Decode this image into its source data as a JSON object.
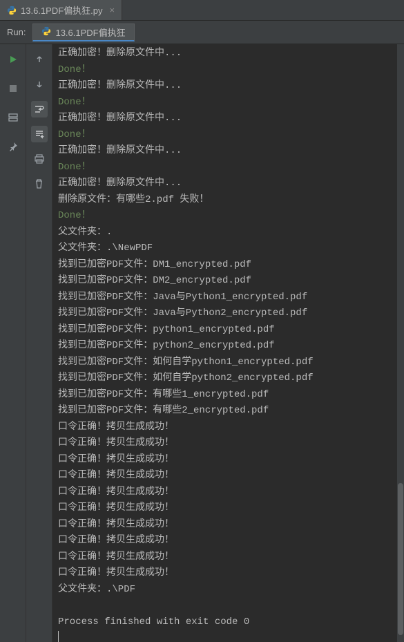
{
  "file_tab": {
    "label": "13.6.1PDF偏执狂.py"
  },
  "run": {
    "label": "Run:",
    "config": "13.6.1PDF偏执狂"
  },
  "console_lines": [
    {
      "cls": "",
      "text": "正确加密！删除原文件中..."
    },
    {
      "cls": "green",
      "text": "Done！"
    },
    {
      "cls": "",
      "text": "正确加密！删除原文件中..."
    },
    {
      "cls": "green",
      "text": "Done！"
    },
    {
      "cls": "",
      "text": "正确加密！删除原文件中..."
    },
    {
      "cls": "green",
      "text": "Done！"
    },
    {
      "cls": "",
      "text": "正确加密！删除原文件中..."
    },
    {
      "cls": "green",
      "text": "Done！"
    },
    {
      "cls": "",
      "text": "正确加密！删除原文件中..."
    },
    {
      "cls": "",
      "text": "删除原文件：有哪些2.pdf 失败！"
    },
    {
      "cls": "green",
      "text": "Done！"
    },
    {
      "cls": "",
      "text": "父文件夹：."
    },
    {
      "cls": "",
      "text": "父文件夹：.\\NewPDF"
    },
    {
      "cls": "",
      "text": "找到已加密PDF文件：DM1_encrypted.pdf"
    },
    {
      "cls": "",
      "text": "找到已加密PDF文件：DM2_encrypted.pdf"
    },
    {
      "cls": "",
      "text": "找到已加密PDF文件：Java与Python1_encrypted.pdf"
    },
    {
      "cls": "",
      "text": "找到已加密PDF文件：Java与Python2_encrypted.pdf"
    },
    {
      "cls": "",
      "text": "找到已加密PDF文件：python1_encrypted.pdf"
    },
    {
      "cls": "",
      "text": "找到已加密PDF文件：python2_encrypted.pdf"
    },
    {
      "cls": "",
      "text": "找到已加密PDF文件：如何自学python1_encrypted.pdf"
    },
    {
      "cls": "",
      "text": "找到已加密PDF文件：如何自学python2_encrypted.pdf"
    },
    {
      "cls": "",
      "text": "找到已加密PDF文件：有哪些1_encrypted.pdf"
    },
    {
      "cls": "",
      "text": "找到已加密PDF文件：有哪些2_encrypted.pdf"
    },
    {
      "cls": "",
      "text": "口令正确！拷贝生成成功！"
    },
    {
      "cls": "",
      "text": "口令正确！拷贝生成成功！"
    },
    {
      "cls": "",
      "text": "口令正确！拷贝生成成功！"
    },
    {
      "cls": "",
      "text": "口令正确！拷贝生成成功！"
    },
    {
      "cls": "",
      "text": "口令正确！拷贝生成成功！"
    },
    {
      "cls": "",
      "text": "口令正确！拷贝生成成功！"
    },
    {
      "cls": "",
      "text": "口令正确！拷贝生成成功！"
    },
    {
      "cls": "",
      "text": "口令正确！拷贝生成成功！"
    },
    {
      "cls": "",
      "text": "口令正确！拷贝生成成功！"
    },
    {
      "cls": "",
      "text": "口令正确！拷贝生成成功！"
    },
    {
      "cls": "",
      "text": "父文件夹：.\\PDF"
    },
    {
      "cls": "",
      "text": ""
    },
    {
      "cls": "",
      "text": "Process finished with exit code 0"
    }
  ]
}
